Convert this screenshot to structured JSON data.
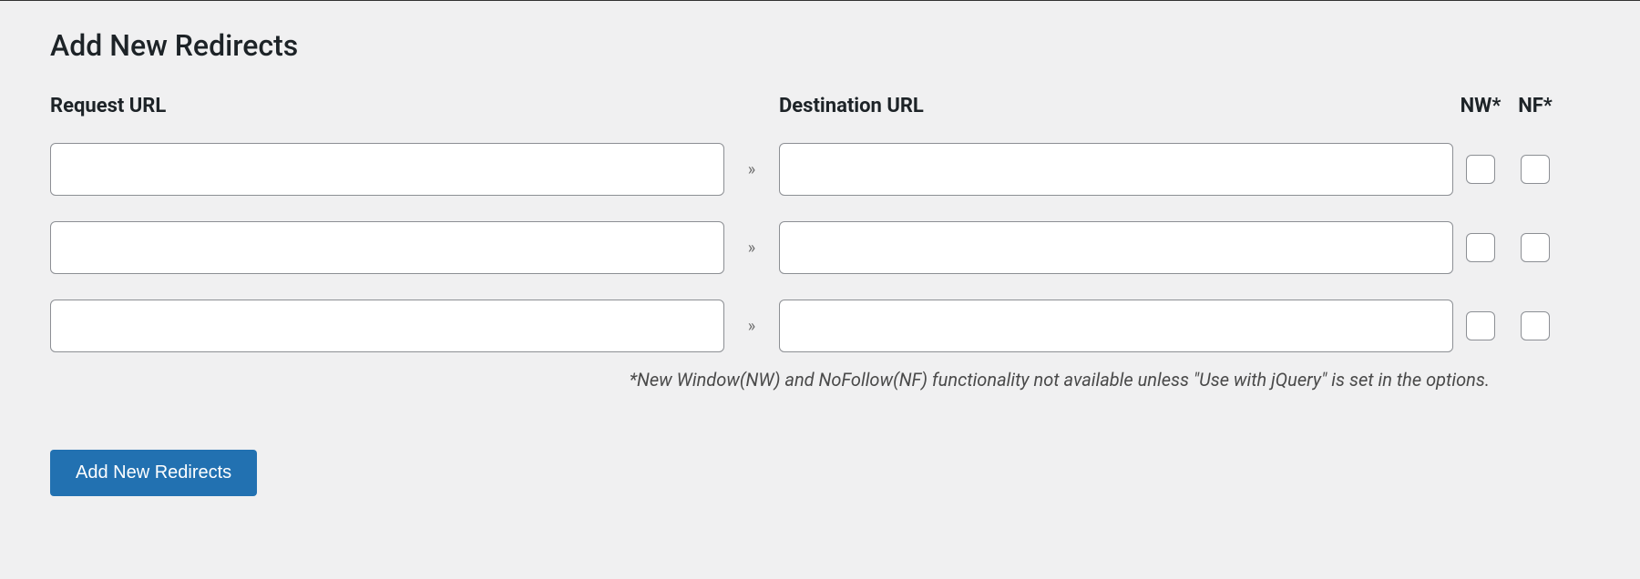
{
  "heading": "Add New Redirects",
  "columns": {
    "request": "Request URL",
    "destination": "Destination URL",
    "nw": "NW*",
    "nf": "NF*"
  },
  "arrow_glyph": "»",
  "rows": [
    {
      "request": "",
      "destination": "",
      "nw": false,
      "nf": false
    },
    {
      "request": "",
      "destination": "",
      "nw": false,
      "nf": false
    },
    {
      "request": "",
      "destination": "",
      "nw": false,
      "nf": false
    }
  ],
  "footnote": "*New Window(NW) and NoFollow(NF) functionality not available unless \"Use with jQuery\" is set in the options.",
  "submit_label": "Add New Redirects"
}
